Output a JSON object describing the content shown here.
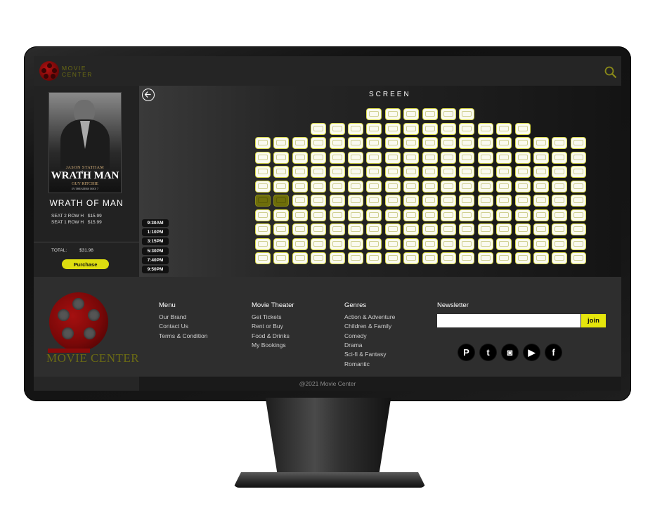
{
  "header": {
    "brand_line1": "MOVIE",
    "brand_line2": "CENTER"
  },
  "poster": {
    "actor": "JASON STATHAM",
    "title": "WRATH MAN",
    "title_of": "of",
    "director": "GUY RITCHIE",
    "release": "IN THEATERS MAY 7"
  },
  "booking": {
    "movie_title": "WRATH OF MAN",
    "seats": [
      {
        "seat": "SEAT 2",
        "row": "ROW H",
        "price": "$15.99"
      },
      {
        "seat": "SEAT 1",
        "row": "ROW H",
        "price": "$15.99"
      }
    ],
    "total_label": "TOTAL:",
    "total_value": "$31.98",
    "purchase_label": "Purchase"
  },
  "screen_label": "SCREEN",
  "seat_map": {
    "top_rows": [
      {
        "row": 1,
        "from": 7,
        "count": 6
      },
      {
        "row": 2,
        "from": 4,
        "count": 12
      }
    ],
    "full_rows": 9,
    "seats_per_row": 18,
    "selected": [
      {
        "row": 7,
        "seat": 1
      },
      {
        "row": 7,
        "seat": 2
      }
    ]
  },
  "showtimes": [
    "9:30AM",
    "1:10PM",
    "3:15PM",
    "5:30PM",
    "7:40PM",
    "9:50PM"
  ],
  "footer": {
    "brand": "MOVIE CENTER",
    "menu": {
      "heading": "Menu",
      "items": [
        "Our Brand",
        "Contact Us",
        "Terms & Condition"
      ]
    },
    "theater": {
      "heading": "Movie Theater",
      "items": [
        "Get Tickets",
        "Rent or Buy",
        "Food & Drinks",
        "My Bookings"
      ]
    },
    "genres": {
      "heading": "Genres",
      "items": [
        "Action & Adventure",
        "Children & Family",
        "Comedy",
        "Drama",
        "Sci-fi & Fantasy",
        "Romantic"
      ]
    },
    "newsletter": {
      "heading": "Newsletter",
      "placeholder": "",
      "join_label": "join"
    },
    "social": [
      {
        "name": "pinterest-icon",
        "glyph": "P"
      },
      {
        "name": "twitter-icon",
        "glyph": "t"
      },
      {
        "name": "instagram-icon",
        "glyph": "◙"
      },
      {
        "name": "youtube-icon",
        "glyph": "▶"
      },
      {
        "name": "facebook-icon",
        "glyph": "f"
      }
    ],
    "copyright": "@2021 Movie Center"
  },
  "colors": {
    "accent": "#e6e60c",
    "brand": "#6b6b14",
    "reel": "#8a0a0a",
    "seat_selected": "#6e6e0a"
  }
}
